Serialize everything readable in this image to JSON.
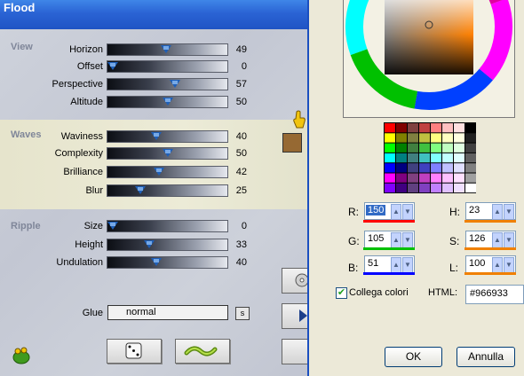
{
  "flood": {
    "title": "Flood",
    "groups": [
      {
        "label": "View",
        "rows": [
          {
            "label": "Horizon",
            "value": "49",
            "percent": 49
          },
          {
            "label": "Offset",
            "value": "0",
            "percent": 0
          },
          {
            "label": "Perspective",
            "value": "57",
            "percent": 57
          },
          {
            "label": "Altitude",
            "value": "50",
            "percent": 50
          }
        ]
      },
      {
        "label": "Waves",
        "rows": [
          {
            "label": "Waviness",
            "value": "40",
            "percent": 40
          },
          {
            "label": "Complexity",
            "value": "50",
            "percent": 50
          },
          {
            "label": "Brilliance",
            "value": "42",
            "percent": 42
          },
          {
            "label": "Blur",
            "value": "25",
            "percent": 25
          }
        ]
      },
      {
        "label": "Ripple",
        "rows": [
          {
            "label": "Size",
            "value": "0",
            "percent": 0
          },
          {
            "label": "Height",
            "value": "33",
            "percent": 33
          },
          {
            "label": "Undulation",
            "value": "40",
            "percent": 40
          }
        ]
      }
    ],
    "glue_label": "Glue",
    "glue_value": "normal",
    "glue_small": "s",
    "swatch_color": "#966933"
  },
  "color": {
    "r_label": "R:",
    "r_value": "150",
    "g_label": "G:",
    "g_value": "105",
    "b_label": "B:",
    "b_value": "51",
    "h_label": "H:",
    "h_value": "23",
    "s_label": "S:",
    "s_value": "126",
    "l_label": "L:",
    "l_value": "100",
    "checkbox_label": "Collega colori",
    "checkbox_checked": true,
    "html_label": "HTML:",
    "html_value": "#966933",
    "ok_label": "OK",
    "cancel_label": "Annulla",
    "palette": [
      [
        "#ff0000",
        "#800000",
        "#804040",
        "#c04040",
        "#ff8080",
        "#ffc0c0",
        "#ffe0e0",
        "#000000"
      ],
      [
        "#ffff00",
        "#808000",
        "#808040",
        "#c0c040",
        "#ffff80",
        "#ffffc0",
        "#ffffe0",
        "#202020"
      ],
      [
        "#00ff00",
        "#008000",
        "#408040",
        "#40c040",
        "#80ff80",
        "#c0ffc0",
        "#e0ffe0",
        "#404040"
      ],
      [
        "#00ffff",
        "#008080",
        "#408080",
        "#40c0c0",
        "#80ffff",
        "#c0ffff",
        "#e0ffff",
        "#606060"
      ],
      [
        "#0000ff",
        "#000080",
        "#404080",
        "#4040c0",
        "#8080ff",
        "#c0c0ff",
        "#e0e0ff",
        "#808080"
      ],
      [
        "#ff00ff",
        "#800080",
        "#804080",
        "#c040c0",
        "#ff80ff",
        "#ffc0ff",
        "#ffe0ff",
        "#a0a0a0"
      ],
      [
        "#8000ff",
        "#400080",
        "#604080",
        "#8040c0",
        "#c080ff",
        "#e0c0ff",
        "#f0e0ff",
        "#ffffff"
      ]
    ]
  }
}
